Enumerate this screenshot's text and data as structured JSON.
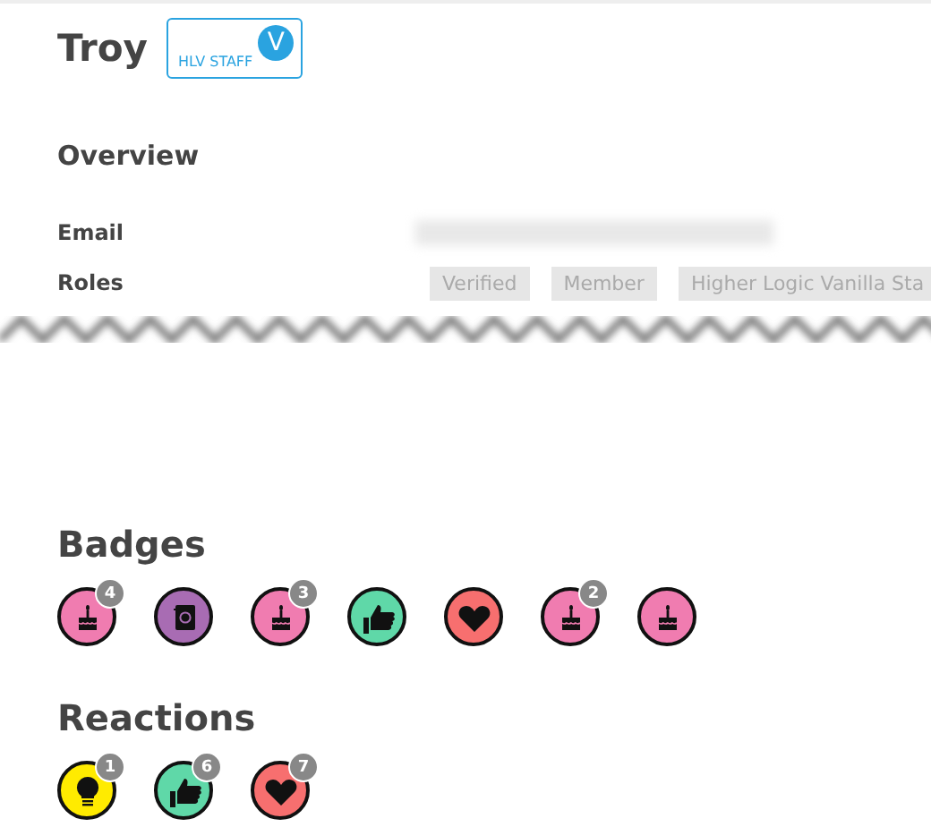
{
  "profile": {
    "name": "Troy",
    "badge": {
      "label": "HLV STAFF",
      "mark": "V"
    }
  },
  "overview": {
    "title": "Overview",
    "fields": [
      {
        "label": "Email",
        "kind": "redacted"
      },
      {
        "label": "Roles",
        "kind": "roles",
        "roles": [
          "Verified",
          "Member",
          "Higher Logic Vanilla Sta"
        ]
      }
    ]
  },
  "badges": {
    "title": "Badges",
    "items": [
      {
        "kind": "cake",
        "color": "#f07cb0",
        "count": "4"
      },
      {
        "kind": "contacts",
        "color": "#a86cb3"
      },
      {
        "kind": "cake",
        "color": "#f07cb0",
        "count": "3"
      },
      {
        "kind": "thumb",
        "color": "#5fd8a8"
      },
      {
        "kind": "heart",
        "color": "#f76f6f"
      },
      {
        "kind": "cake",
        "color": "#f07cb0",
        "count": "2"
      },
      {
        "kind": "cake",
        "color": "#f07cb0"
      }
    ]
  },
  "reactions": {
    "title": "Reactions",
    "items": [
      {
        "kind": "bulb",
        "color": "#ffeb00",
        "count": "1"
      },
      {
        "kind": "thumb",
        "color": "#5fd8a8",
        "count": "6"
      },
      {
        "kind": "heart",
        "color": "#f76f6f",
        "count": "7"
      }
    ]
  }
}
